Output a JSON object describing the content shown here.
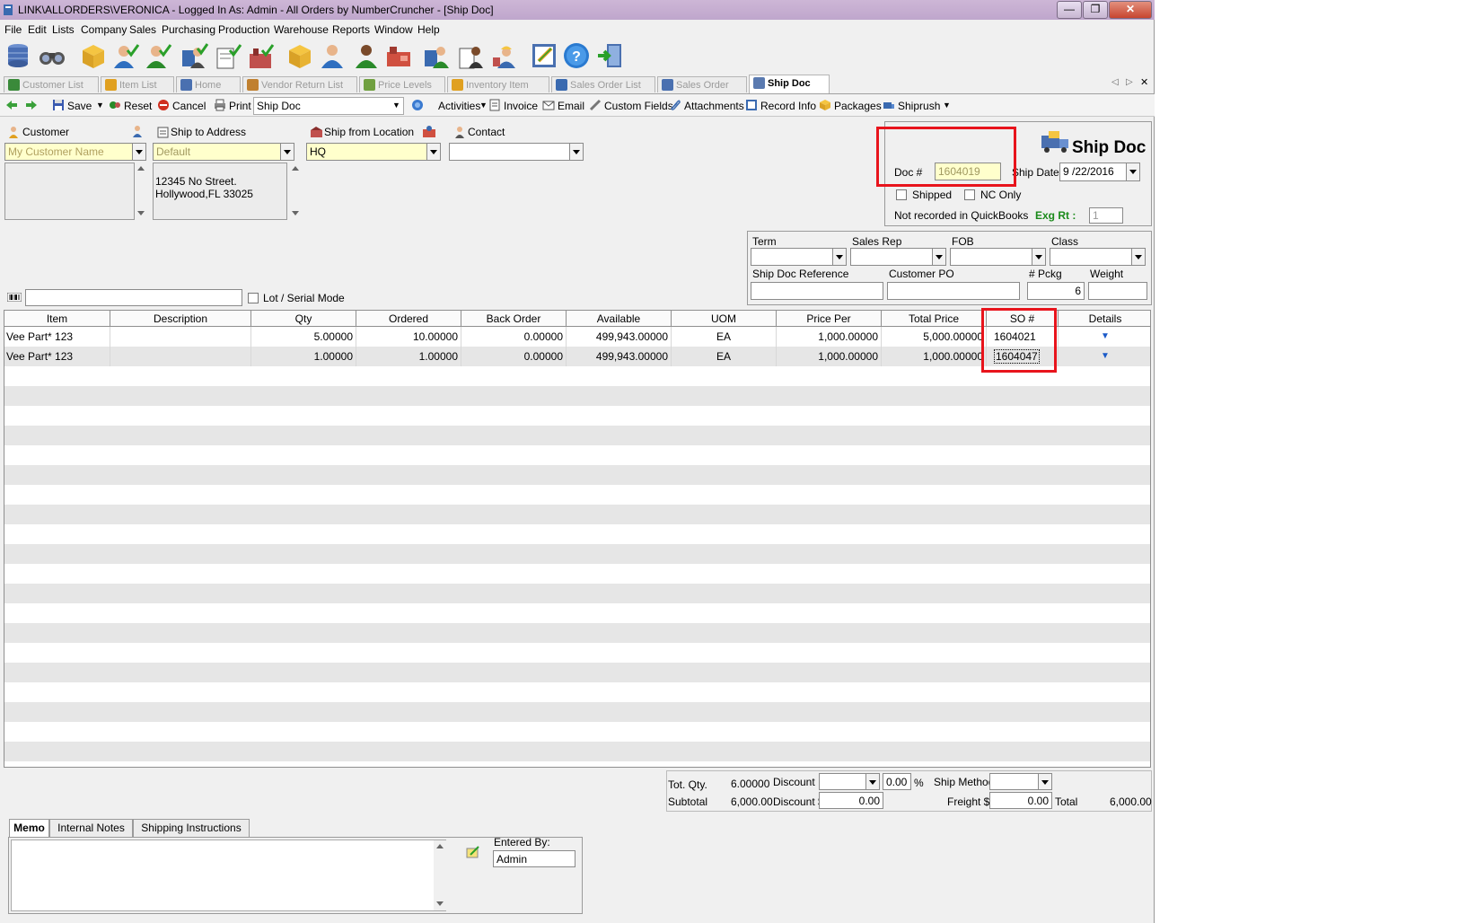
{
  "window": {
    "title": "LINK\\ALLORDERS\\VERONICA - Logged In As: Admin - All Orders by NumberCruncher - [Ship Doc]",
    "minimize": "—",
    "restore": "❐",
    "close": "✕"
  },
  "menu": [
    "File",
    "Edit",
    "Lists",
    "Company",
    "Sales",
    "Purchasing",
    "Production",
    "Warehouse",
    "Reports",
    "Window",
    "Help"
  ],
  "tabs": [
    {
      "label": "Customer List",
      "icon_color": "#3a8a3a"
    },
    {
      "label": "Item List",
      "icon_color": "#e0a020"
    },
    {
      "label": "Home",
      "icon_color": "#4a70b0"
    },
    {
      "label": "Vendor Return List",
      "icon_color": "#c08030"
    },
    {
      "label": "Price Levels",
      "icon_color": "#70a040"
    },
    {
      "label": "Inventory Item",
      "icon_color": "#e0a020"
    },
    {
      "label": "Sales Order List",
      "icon_color": "#3a6ab0"
    },
    {
      "label": "Sales Order",
      "icon_color": "#4a70b0"
    },
    {
      "label": "Ship Doc",
      "icon_color": "#5a7ab0"
    }
  ],
  "tab_nav": {
    "prev": "◁",
    "next": "▷",
    "close": "✕"
  },
  "toolbar": {
    "save": "Save",
    "reset": "Reset",
    "cancel": "Cancel",
    "print": "Print",
    "print_doc": "Ship Doc",
    "activities": "Activities",
    "invoice": "Invoice",
    "email": "Email",
    "custom_fields": "Custom Fields",
    "attachments": "Attachments",
    "record_info": "Record Info",
    "packages": "Packages",
    "shiprush": "Shiprush"
  },
  "header": {
    "customer_label": "Customer",
    "customer_value": "My Customer Name",
    "ship_to_label": "Ship to Address",
    "ship_to_value": "Default",
    "ship_to_address_line1": "12345 No Street.",
    "ship_to_address_line2": "Hollywood,FL 33025",
    "ship_from_label": "Ship from Location",
    "ship_from_value": "HQ",
    "contact_label": "Contact",
    "contact_value": ""
  },
  "doc": {
    "title": "Ship Doc",
    "doc_no_label": "Doc #",
    "doc_no": "1604019",
    "ship_date_label": "Ship Date",
    "ship_date": "9 /22/2016",
    "shipped_label": "Shipped",
    "nc_only_label": "NC Only",
    "qb_status": "Not recorded in QuickBooks",
    "exg_rt_label": "Exg Rt :",
    "exg_rt": "1"
  },
  "terms": {
    "term_label": "Term",
    "sales_rep_label": "Sales Rep",
    "fob_label": "FOB",
    "class_label": "Class",
    "ship_doc_ref_label": "Ship Doc Reference",
    "customer_po_label": "Customer PO",
    "pckg_label": "# Pckg",
    "weight_label": "Weight",
    "term": "",
    "sales_rep": "",
    "fob": "",
    "class": "",
    "ship_doc_ref": "",
    "customer_po": "",
    "pckg": "6",
    "weight": ""
  },
  "scan": {
    "lot_serial_label": "Lot / Serial Mode",
    "value": ""
  },
  "grid": {
    "columns": [
      "Item",
      "Description",
      "Qty",
      "Ordered",
      "Back Order",
      "Available",
      "UOM",
      "Price Per",
      "Total Price",
      "SO #",
      "Details"
    ],
    "rows": [
      {
        "item": "Vee Part* 123",
        "description": "",
        "qty": "5.00000",
        "ordered": "10.00000",
        "back_order": "0.00000",
        "available": "499,943.00000",
        "uom": "EA",
        "price_per": "1,000.00000",
        "total_price": "5,000.00000",
        "so": "1604021"
      },
      {
        "item": "Vee Part* 123",
        "description": "",
        "qty": "1.00000",
        "ordered": "1.00000",
        "back_order": "0.00000",
        "available": "499,943.00000",
        "uom": "EA",
        "price_per": "1,000.00000",
        "total_price": "1,000.00000",
        "so": "1604047"
      }
    ]
  },
  "totals": {
    "tot_qty_label": "Tot. Qty.",
    "tot_qty": "6.00000",
    "subtotal_label": "Subtotal",
    "subtotal": "6,000.00",
    "discount_label": "Discount",
    "discount_pct": "0.00",
    "pct_sign": "%",
    "discount_amt_label": "Discount $",
    "discount_amt": "0.00",
    "ship_method_label": "Ship Method",
    "ship_method": "",
    "freight_label": "Freight $",
    "freight": "0.00",
    "total_label": "Total",
    "total": "6,000.00"
  },
  "notes": {
    "tabs": [
      "Memo",
      "Internal Notes",
      "Shipping Instructions"
    ],
    "entered_by_label": "Entered By:",
    "entered_by": "Admin",
    "memo": ""
  },
  "colors": {
    "highlight_red": "#e8141c",
    "field_yellow": "#ffffcc",
    "title_bar": "#c7b0d2"
  }
}
